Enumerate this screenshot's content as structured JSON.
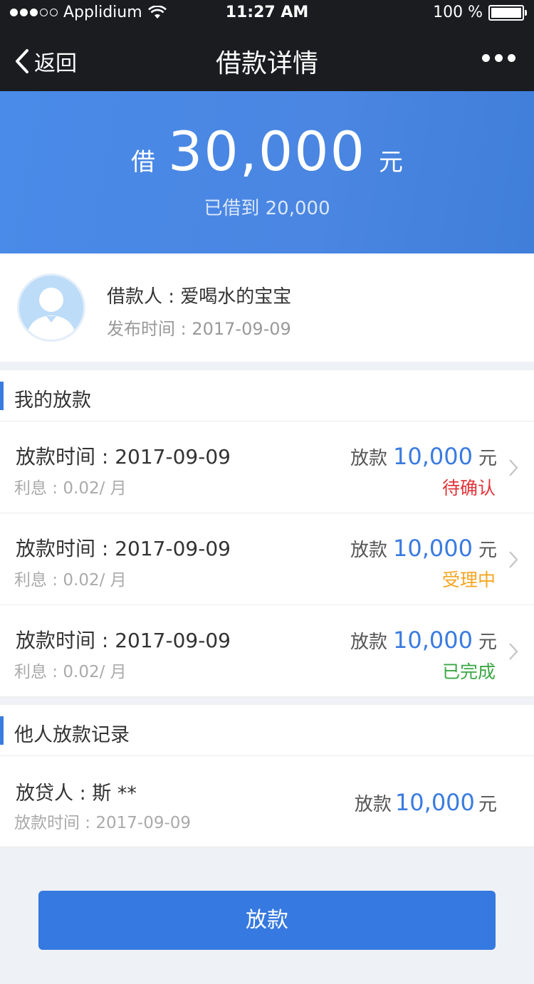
{
  "status_bar": {
    "carrier": "Applidium",
    "time": "11:27 AM",
    "battery": "100 %"
  },
  "nav": {
    "back_label": "返回",
    "title": "借款详情"
  },
  "hero": {
    "prefix": "借",
    "amount": "30,000",
    "unit": "元",
    "borrowed_text": "已借到 20,000"
  },
  "borrower": {
    "name_text": "借款人 : 爱喝水的宝宝",
    "publish_text": "发布时间 : 2017-09-09"
  },
  "my_loans": {
    "title": "我的放款",
    "items": [
      {
        "time": "放款时间 : 2017-09-09",
        "interest": "利息 : 0.02/ 月",
        "label": "放款",
        "amount": "10,000",
        "unit": "元",
        "status": "待确认",
        "status_color": "#e0353a"
      },
      {
        "time": "放款时间 : 2017-09-09",
        "interest": "利息 : 0.02/ 月",
        "label": "放款",
        "amount": "10,000",
        "unit": "元",
        "status": "受理中",
        "status_color": "#f5a623"
      },
      {
        "time": "放款时间 : 2017-09-09",
        "interest": "利息 : 0.02/ 月",
        "label": "放款",
        "amount": "10,000",
        "unit": "元",
        "status": "已完成",
        "status_color": "#3aa844"
      }
    ]
  },
  "other_loans": {
    "title": "他人放款记录",
    "items": [
      {
        "lender": "放贷人 : 斯 **",
        "time": "放款时间 : 2017-09-09",
        "label": "放款",
        "amount": "10,000",
        "unit": "元"
      }
    ]
  },
  "action": {
    "button_label": "放款"
  },
  "colors": {
    "accent": "#3a7be0",
    "nav_bg": "#1b1c20"
  }
}
